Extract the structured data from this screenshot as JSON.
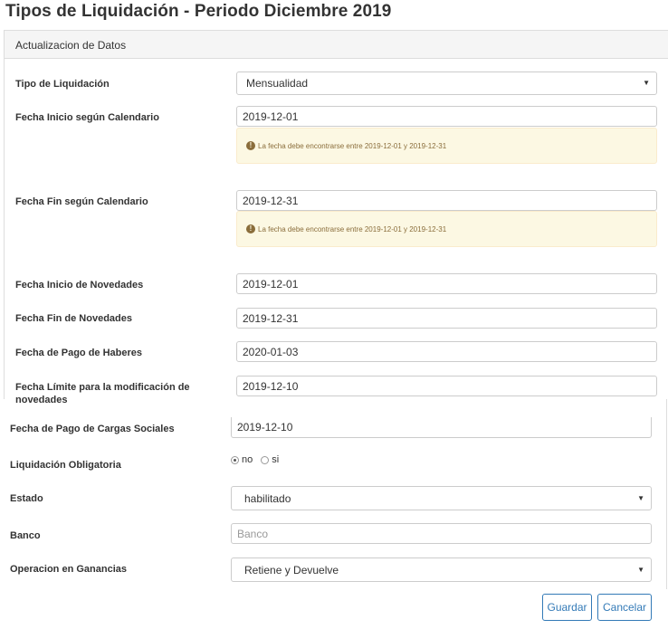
{
  "page_title": "Tipos de Liquidación - Periodo Diciembre 2019",
  "panel": {
    "heading": "Actualizacion de Datos"
  },
  "fields": {
    "tipo_liquidacion": {
      "label": "Tipo de Liquidación",
      "value": "Mensualidad"
    },
    "fecha_inicio_calendario": {
      "label": "Fecha Inicio según Calendario",
      "value": "2019-12-01",
      "warning": "La fecha debe encontrarse entre 2019-12-01 y 2019-12-31"
    },
    "fecha_fin_calendario": {
      "label": "Fecha Fin según Calendario",
      "value": "2019-12-31",
      "warning": "La fecha debe encontrarse entre 2019-12-01 y 2019-12-31"
    },
    "fecha_inicio_novedades": {
      "label": "Fecha Inicio de Novedades",
      "value": "2019-12-01"
    },
    "fecha_fin_novedades": {
      "label": "Fecha Fin de Novedades",
      "value": "2019-12-31"
    },
    "fecha_pago_haberes": {
      "label": "Fecha de Pago de Haberes",
      "value": "2020-01-03"
    },
    "fecha_limite_modificacion": {
      "label_line1": "Fecha Límite para la modificación de",
      "label_line2": "novedades",
      "value": "2019-12-10"
    },
    "fecha_pago_cargas_sociales": {
      "label": "Fecha de Pago de Cargas Sociales",
      "value": "2019-12-10"
    },
    "liquidacion_obligatoria": {
      "label": "Liquidación Obligatoria",
      "options": [
        "no",
        "si"
      ],
      "selected": "no"
    },
    "estado": {
      "label": "Estado",
      "value": "habilitado"
    },
    "banco": {
      "label": "Banco",
      "placeholder": "Banco"
    },
    "operacion_ganancias": {
      "label": "Operacion en Ganancias",
      "value": "Retiene y Devuelve"
    }
  },
  "actions": {
    "save_label": "Guardar",
    "cancel_label": "Cancelar"
  },
  "icons": {
    "warning": "exclamation-circle-icon",
    "select_caret": "caret-down-icon"
  },
  "colors": {
    "primary": "#337ab7",
    "warning_bg": "#fcf8e3",
    "warning_text": "#8a6d3b"
  }
}
